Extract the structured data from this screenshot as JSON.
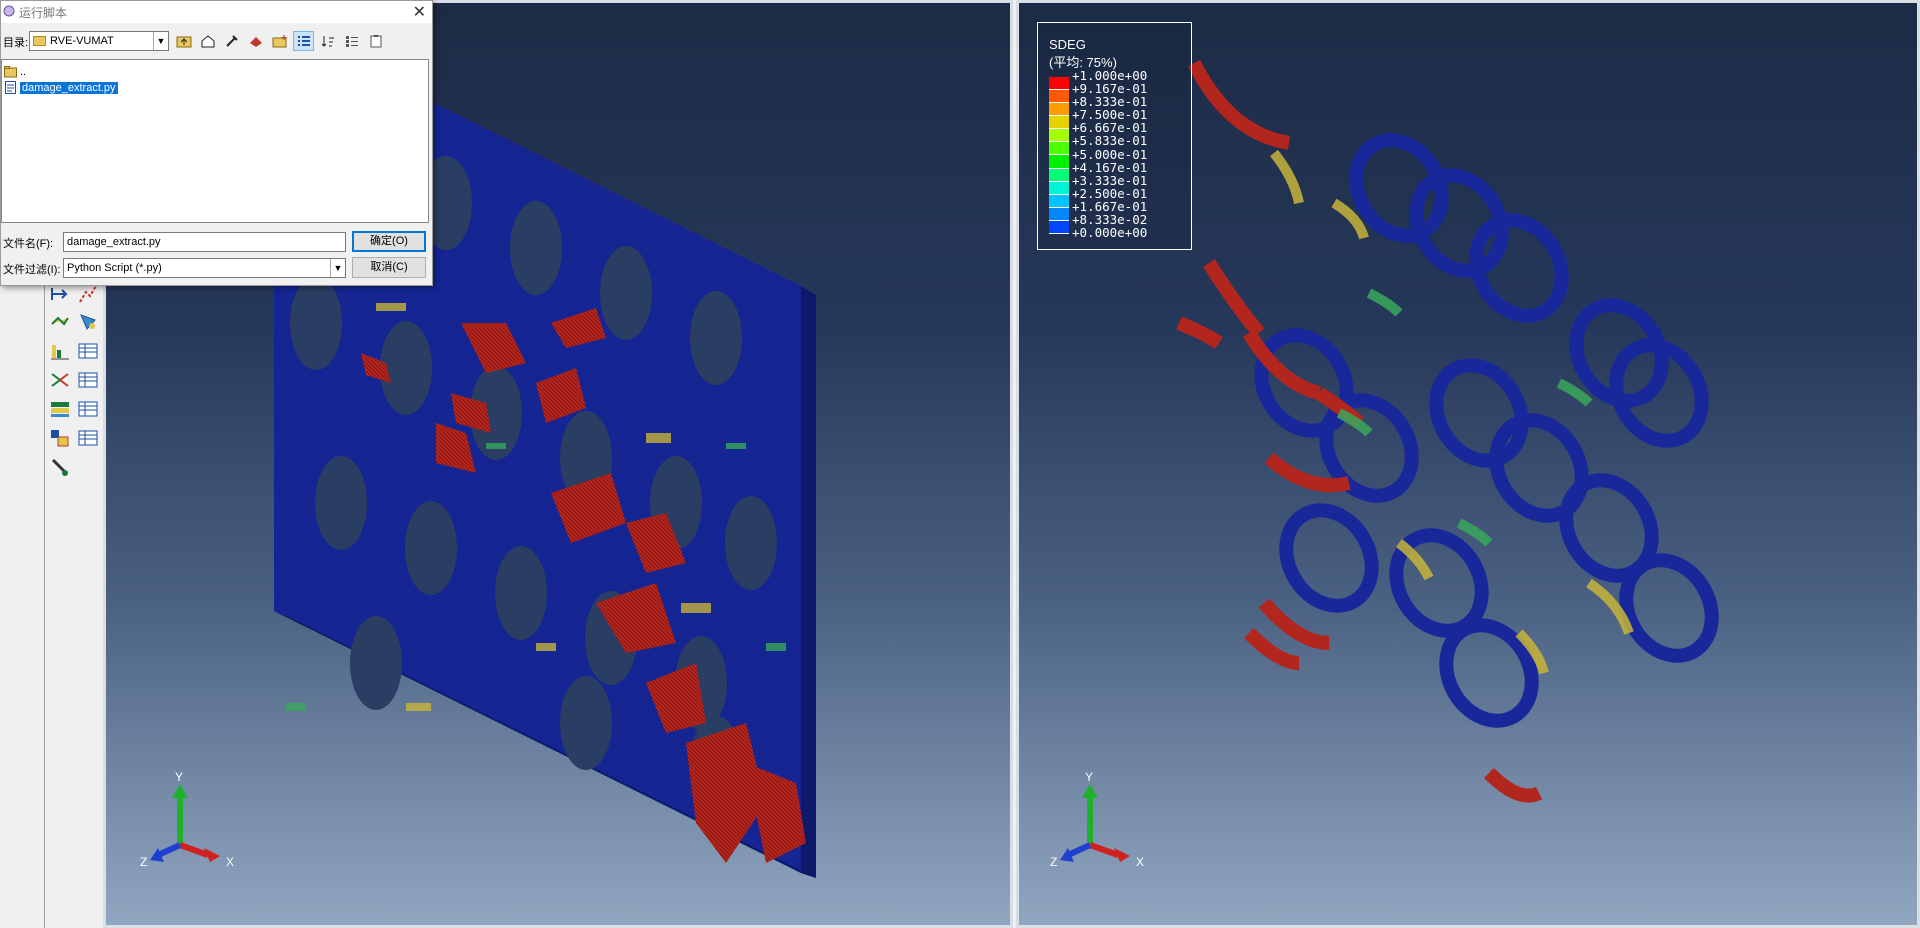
{
  "dialog": {
    "title": "运行脚本",
    "close_glyph": "✕",
    "dir_label": "目录:",
    "dir_value": "RVE-VUMAT",
    "files": [
      {
        "name": "..",
        "icon": "folder-icon"
      },
      {
        "name": "damage_extract.py",
        "icon": "python-file-icon",
        "selected": true
      }
    ],
    "filename_label": "文件名(F):",
    "filename_value": "damage_extract.py",
    "filetype_label": "文件过滤(I):",
    "filetype_value": "Python Script (*.py)",
    "ok_label": "确定(O)",
    "cancel_label": "取消(C)"
  },
  "legend": {
    "title": "SDEG",
    "subtitle": "(平均: 75%)",
    "values": [
      "+1.000e+00",
      "+9.167e-01",
      "+8.333e-01",
      "+7.500e-01",
      "+6.667e-01",
      "+5.833e-01",
      "+5.000e-01",
      "+4.167e-01",
      "+3.333e-01",
      "+2.500e-01",
      "+1.667e-01",
      "+8.333e-02",
      "+0.000e+00"
    ],
    "colors": [
      "#ff0000",
      "#ff5a00",
      "#ff9c00",
      "#e6d200",
      "#a6ff00",
      "#4dff00",
      "#00f000",
      "#00ff76",
      "#00f5d6",
      "#00c3ff",
      "#0086ff",
      "#0046ff",
      "#0000ff"
    ]
  },
  "triad": {
    "y": "Y",
    "x": "X",
    "z": "Z"
  },
  "colors": {
    "mesh_blue": "#18289a",
    "damage_red": "#b3261e",
    "damage_yellow": "#c7b43a",
    "damage_green": "#3aa85a"
  }
}
